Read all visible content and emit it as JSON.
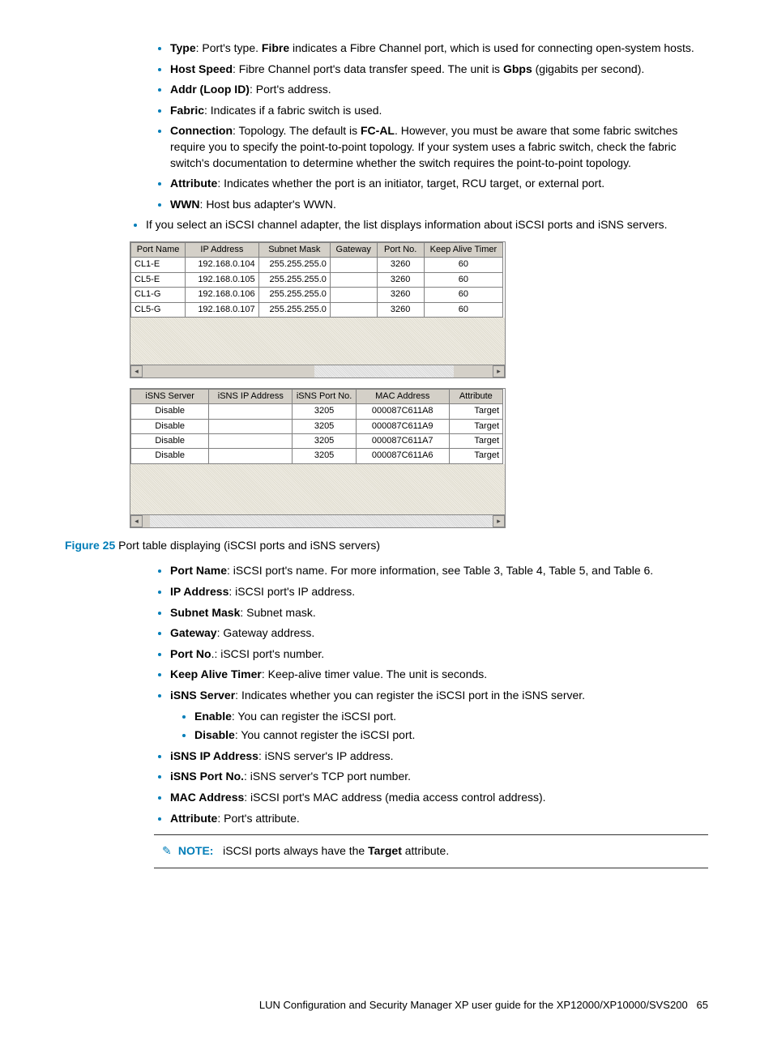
{
  "bullets_top": {
    "type": {
      "label": "Type",
      "text": ": Port's type. ",
      "bold2": "Fibre",
      "text2": " indicates a Fibre Channel port, which is used for connecting open-system hosts."
    },
    "hostspeed": {
      "label": "Host Speed",
      "text": ": Fibre Channel port's data transfer speed. The unit is ",
      "bold2": "Gbps",
      "text2": " (gigabits per second)."
    },
    "addr": {
      "label": "Addr (Loop ID)",
      "text": ": Port's address."
    },
    "fabric": {
      "label": "Fabric",
      "text": ": Indicates if a fabric switch is used."
    },
    "connection": {
      "label": "Connection",
      "text": ": Topology. The default is ",
      "bold2": "FC-AL",
      "text2": ". However, you must be aware that some fabric switches require you to specify the point-to-point topology. If your system uses a fabric switch, check the fabric switch's documentation to determine whether the switch requires the point-to-point topology."
    },
    "attribute": {
      "label": "Attribute",
      "text": ": Indicates whether the port is an initiator, target, RCU target, or external port."
    },
    "wwn": {
      "label": "WWN",
      "text": ": Host bus adapter's WWN."
    }
  },
  "outer_bullet": "If you select an iSCSI channel adapter, the list displays information about iSCSI ports and iSNS servers.",
  "table1": {
    "headers": [
      "Port Name",
      "IP Address",
      "Subnet Mask",
      "Gateway",
      "Port No.",
      "Keep Alive Timer"
    ],
    "rows": [
      [
        "CL1-E",
        "192.168.0.104",
        "255.255.255.0",
        "",
        "3260",
        "60"
      ],
      [
        "CL5-E",
        "192.168.0.105",
        "255.255.255.0",
        "",
        "3260",
        "60"
      ],
      [
        "CL1-G",
        "192.168.0.106",
        "255.255.255.0",
        "",
        "3260",
        "60"
      ],
      [
        "CL5-G",
        "192.168.0.107",
        "255.255.255.0",
        "",
        "3260",
        "60"
      ]
    ]
  },
  "table2": {
    "headers": [
      "iSNS Server",
      "iSNS IP Address",
      "iSNS Port No.",
      "MAC Address",
      "Attribute"
    ],
    "rows": [
      [
        "Disable",
        "",
        "3205",
        "000087C611A8",
        "Target"
      ],
      [
        "Disable",
        "",
        "3205",
        "000087C611A9",
        "Target"
      ],
      [
        "Disable",
        "",
        "3205",
        "000087C611A7",
        "Target"
      ],
      [
        "Disable",
        "",
        "3205",
        "000087C611A6",
        "Target"
      ]
    ]
  },
  "caption": {
    "figlabel": "Figure 25",
    "text": "  Port table displaying (iSCSI ports and iSNS servers)"
  },
  "bullets_bottom": {
    "portname": {
      "label": "Port Name",
      "text": ": iSCSI port's name. For more information, see Table 3, Table 4, Table 5, and Table 6."
    },
    "ipaddress": {
      "label": "IP Address",
      "text": ": iSCSI port's IP address."
    },
    "subnet": {
      "label": "Subnet Mask",
      "text": ": Subnet mask."
    },
    "gateway": {
      "label": "Gateway",
      "text": ": Gateway address."
    },
    "portno": {
      "label": "Port No",
      "text": ".: iSCSI port's number."
    },
    "keepalive": {
      "label": "Keep Alive Timer",
      "text": ": Keep-alive timer value. The unit is seconds."
    },
    "isnsserver": {
      "label": "iSNS Server",
      "text": ": Indicates whether you can register the iSCSI port in the iSNS server."
    },
    "enable": {
      "label": "Enable",
      "text": ": You can register the iSCSI port."
    },
    "disable": {
      "label": "Disable",
      "text": ": You cannot register the iSCSI port."
    },
    "isnsip": {
      "label": "iSNS IP Address",
      "text": ": iSNS server's IP address."
    },
    "isnsport": {
      "label": "iSNS Port No.",
      "text": ": iSNS server's TCP port number."
    },
    "mac": {
      "label": "MAC Address",
      "text": ": iSCSI port's MAC address (media access control address)."
    },
    "attribute": {
      "label": "Attribute",
      "text": ": Port's attribute."
    }
  },
  "note": {
    "label": "NOTE:",
    "pre": "iSCSI ports always have the ",
    "bold": "Target",
    "post": " attribute."
  },
  "footer": {
    "text": "LUN Configuration and Security Manager XP user guide for the XP12000/XP10000/SVS200",
    "page": "65"
  }
}
